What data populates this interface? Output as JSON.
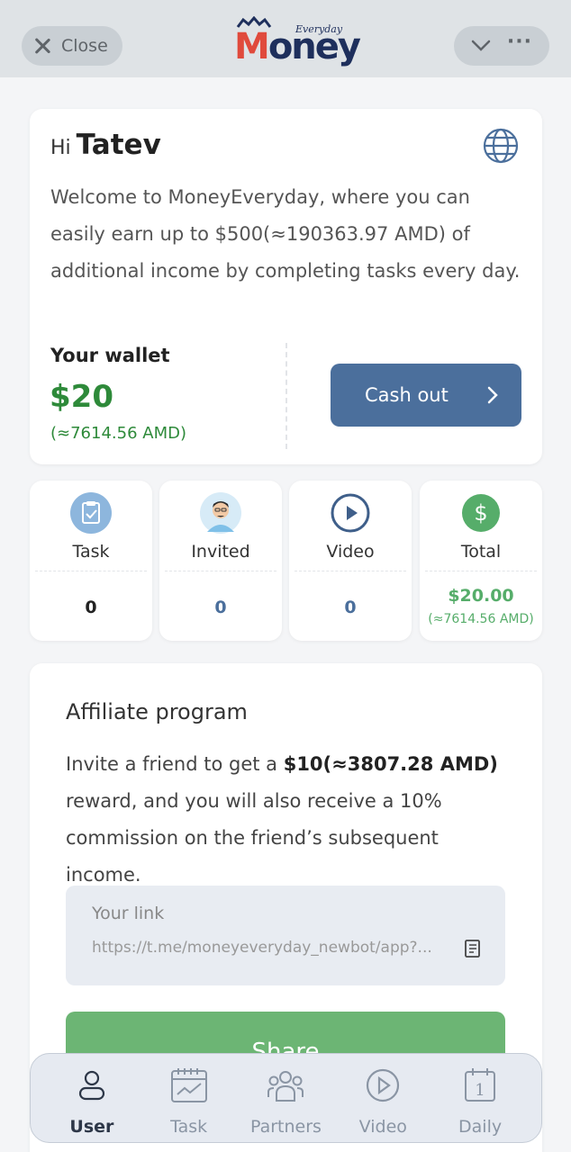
{
  "topbar": {
    "close_label": "Close"
  },
  "logo": {
    "everyday": "Everyday",
    "money_m": "M",
    "money_rest": "oney"
  },
  "greeting": {
    "hi": "Hi",
    "name": "Tatev"
  },
  "intro": "Welcome to MoneyEveryday, where you can easily earn up to $500(≈190363.97 AMD) of additional income by completing tasks every day.",
  "wallet": {
    "title": "Your wallet",
    "amount": "$20",
    "amd": "(≈7614.56 AMD)",
    "cashout_label": "Cash out"
  },
  "stats": [
    {
      "label": "Task",
      "value": "0",
      "icon": "clipboard-icon"
    },
    {
      "label": "Invited",
      "value": "0",
      "icon": "avatar-icon"
    },
    {
      "label": "Video",
      "value": "0",
      "icon": "play-icon"
    },
    {
      "label": "Total",
      "value": "$20.00",
      "sub": "(≈7614.56 AMD)",
      "icon": "dollar-icon"
    }
  ],
  "affiliate": {
    "title": "Affiliate program",
    "text_before": "Invite a friend to get a ",
    "text_bold": "$10(≈3807.28 AMD)",
    "text_after": " reward, and you will also receive a 10% commission on the friend’s subsequent income.",
    "link_label": "Your link",
    "link_value": "https://t.me/moneyeveryday_newbot/app?...",
    "share_label": "Share"
  },
  "tabs": [
    {
      "label": "User",
      "icon": "user-icon"
    },
    {
      "label": "Task",
      "icon": "task-calendar-icon"
    },
    {
      "label": "Partners",
      "icon": "partners-icon"
    },
    {
      "label": "Video",
      "icon": "video-play-icon"
    },
    {
      "label": "Daily",
      "icon": "daily-calendar-icon"
    }
  ],
  "colors": {
    "primary": "#4b6f9c",
    "green": "#2e8a3a",
    "share": "#6cb574"
  }
}
